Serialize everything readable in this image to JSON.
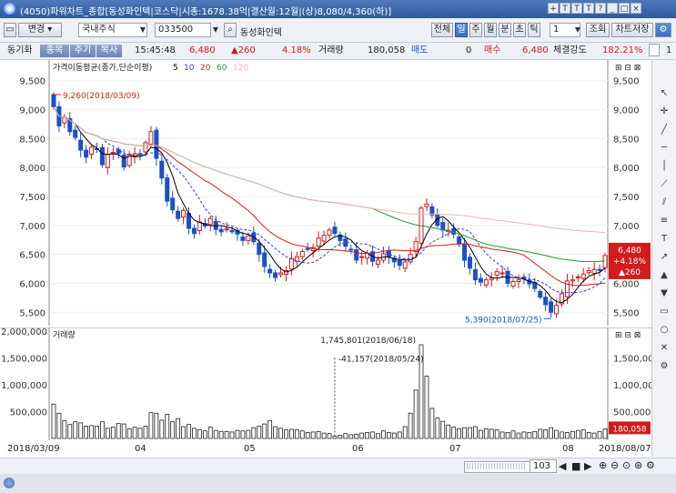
{
  "window": {
    "title": "(4050)파워차트_종합[동성화인텍|코스닥|시총:1678.38억|결산월:12월|(상)8,080/4,360(하)]",
    "controls": [
      "+",
      "T",
      "T",
      "T",
      "?",
      "_",
      "□",
      "×"
    ]
  },
  "toolbar": {
    "change_label": "변경",
    "market_select": "국내주식",
    "code": "033500",
    "stock_name": "동성화인텍",
    "period_buttons": [
      "전체",
      "일",
      "주",
      "월",
      "분",
      "초",
      "틱"
    ],
    "active_period": "일",
    "interval_value": "1",
    "lookup_button": "조회",
    "save_button": "차트저장"
  },
  "quote": {
    "sync_label": "동기화",
    "tabs": [
      "종목",
      "주기",
      "복사"
    ],
    "time": "15:45:48",
    "price": "6,480",
    "change": "▲260",
    "change_rate": "4.18%",
    "volume_label": "거래량",
    "volume": "180,058",
    "bid_label": "매도",
    "bid_value": "0",
    "ask_label": "매수",
    "ask_value": "6,480",
    "strength_label": "체결강도",
    "strength_value": "182.21%",
    "count": "1"
  },
  "price_pane": {
    "legend_prefix": "가격이동평균(종가,단순이평)",
    "ma_periods": [
      "5",
      "10",
      "20",
      "60",
      "120"
    ],
    "ma_colors": [
      "#000000",
      "#3a3ad8",
      "#d01c1c",
      "#1f9a3a",
      "#f0b5b5"
    ],
    "y_ticks": [
      "9,500",
      "9,000",
      "8,500",
      "8,000",
      "7,500",
      "7,000",
      "6,500",
      "6,000",
      "5,500"
    ],
    "high_annotation": "9,260(2018/03/09)",
    "low_annotation": "5,390(2018/07/25)",
    "current_box": {
      "price": "6,480",
      "rate": "+4.18%",
      "change": "▲260"
    },
    "up_color": "#d01c1c",
    "down_color": "#1a50c8"
  },
  "volume_pane": {
    "legend": "거래량",
    "y_ticks_left": [
      "2,000,000",
      "1,500,000",
      "1,000,000",
      "500,000"
    ],
    "y_ticks_right": [
      "1,500,000",
      "1,000,000",
      "500,000"
    ],
    "max_annotation": "1,745,801(2018/06/18)",
    "min_annotation": "41,157(2018/05/24)",
    "current_volume": "180,058"
  },
  "x_axis": {
    "labels": [
      "2018/03/09",
      "04",
      "05",
      "06",
      "07",
      "08",
      "2018/08/07"
    ]
  },
  "navigator": {
    "count": "103"
  },
  "chart_data": [
    {
      "type": "candlestick",
      "title": "가격이동평균(종가,단순이평)",
      "ylim": [
        5300,
        9700
      ],
      "period": [
        "2018/03/09",
        "2018/08/07"
      ],
      "close": [
        9050,
        8720,
        8870,
        8620,
        8520,
        8300,
        8180,
        8350,
        8320,
        8050,
        8230,
        8260,
        8240,
        8010,
        8230,
        8240,
        8220,
        8430,
        8620,
        8160,
        7820,
        7420,
        7270,
        7120,
        7260,
        6950,
        6860,
        7060,
        6990,
        7120,
        6930,
        6890,
        6940,
        6890,
        6850,
        6740,
        6820,
        6720,
        6500,
        6290,
        6180,
        6100,
        6180,
        6220,
        6430,
        6460,
        6550,
        6590,
        6620,
        6780,
        6830,
        6920,
        6860,
        6740,
        6640,
        6580,
        6400,
        6460,
        6520,
        6380,
        6400,
        6510,
        6460,
        6370,
        6310,
        6370,
        6500,
        6720,
        7300,
        7370,
        7180,
        7000,
        6920,
        6920,
        6850,
        6680,
        6400,
        6260,
        6060,
        6020,
        6060,
        6090,
        6200,
        6180,
        6000,
        6030,
        6060,
        6080,
        5990,
        5910,
        5760,
        5630,
        5500,
        5620,
        5820,
        6040,
        6060,
        6110,
        6160,
        6220,
        6240,
        6220,
        6480
      ],
      "ma_series": [
        "5",
        "10",
        "20",
        "60",
        "120"
      ],
      "annotations": [
        "9,260(2018/03/09)",
        "5,390(2018/07/25)"
      ]
    },
    {
      "type": "bar",
      "title": "거래량",
      "ylim": [
        0,
        2000000
      ],
      "values": [
        640000,
        470000,
        330000,
        260000,
        310000,
        290000,
        230000,
        240000,
        230000,
        310000,
        190000,
        210000,
        280000,
        270000,
        180000,
        210000,
        190000,
        230000,
        480000,
        470000,
        340000,
        450000,
        310000,
        370000,
        220000,
        260000,
        190000,
        160000,
        140000,
        210000,
        150000,
        130000,
        130000,
        120000,
        150000,
        140000,
        150000,
        200000,
        230000,
        270000,
        330000,
        220000,
        190000,
        160000,
        170000,
        160000,
        140000,
        110000,
        120000,
        130000,
        100000,
        90000,
        41157,
        60000,
        90000,
        70000,
        80000,
        100000,
        110000,
        120000,
        90000,
        140000,
        110000,
        100000,
        120000,
        220000,
        470000,
        900000,
        1745801,
        1160000,
        560000,
        380000,
        320000,
        250000,
        210000,
        180000,
        200000,
        200000,
        220000,
        150000,
        180000,
        170000,
        160000,
        120000,
        110000,
        140000,
        100000,
        120000,
        110000,
        130000,
        170000,
        160000,
        200000,
        150000,
        120000,
        110000,
        130000,
        150000,
        160000,
        110000,
        100000,
        130000,
        180058
      ],
      "annotations": [
        "1,745,801(2018/06/18)",
        "41,157(2018/05/24)"
      ]
    }
  ],
  "sidebar_icons": [
    "cursor-icon",
    "crosshair-icon",
    "line-icon",
    "hline-icon",
    "vline-icon",
    "trend-icon",
    "channel-icon",
    "fibo-icon",
    "text-icon",
    "arrow-icon",
    "up-arrow-icon",
    "down-arrow-icon",
    "rect-icon",
    "circle-icon",
    "delete-icon",
    "settings-icon"
  ]
}
